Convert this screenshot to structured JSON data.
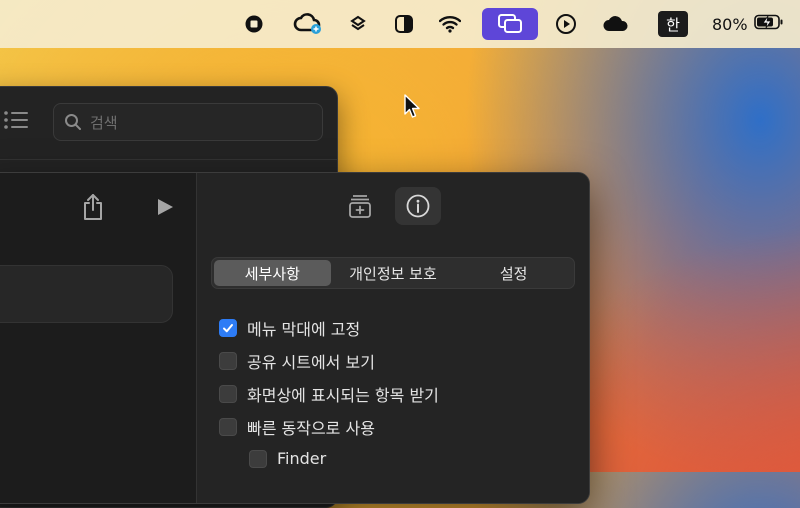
{
  "menubar": {
    "input_method": "한",
    "battery_percent": "80%",
    "icons": [
      "stop-record-icon",
      "creative-cloud-icon",
      "dropbox-icon",
      "contrast-icon",
      "wifi-icon",
      "screens-icon",
      "play-icon",
      "cloud-icon",
      "battery-charging-icon"
    ]
  },
  "back_window": {
    "search_placeholder": "검색"
  },
  "inspector": {
    "tabs": [
      "세부사항",
      "개인정보 보호",
      "설정"
    ],
    "selected_tab": "세부사항",
    "options": [
      {
        "label": "메뉴 막대에 고정",
        "checked": true
      },
      {
        "label": "공유 시트에서 보기",
        "checked": false
      },
      {
        "label": "화면상에 표시되는 항목 받기",
        "checked": false
      },
      {
        "label": "빠른 동작으로 사용",
        "checked": false
      },
      {
        "label": "Finder",
        "checked": false
      }
    ]
  },
  "colors": {
    "accent": "#2d7cf6",
    "menubar_active": "#5e46d8"
  }
}
